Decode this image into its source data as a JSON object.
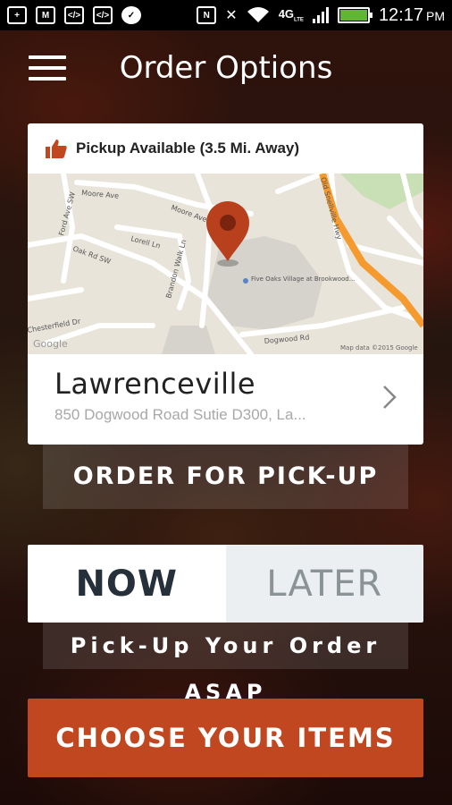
{
  "status_bar": {
    "time": "12:17",
    "ampm": "PM",
    "network": "4G",
    "network_sub": "LTE",
    "icons": [
      "plus-box-icon",
      "gmail-icon",
      "code-icon",
      "code-icon",
      "chat-icon",
      "nfc-icon",
      "mute-icon",
      "wifi-icon",
      "signal-icon",
      "battery-icon"
    ]
  },
  "header": {
    "title": "Order Options",
    "menu_icon": "hamburger-menu-icon"
  },
  "location_card": {
    "pickup_text": "Pickup Available (3.5 Mi. Away)",
    "pickup_icon": "thumbs-up-icon",
    "map": {
      "streets": [
        "Moore Ave",
        "Moore Ave",
        "Ford Ave SW",
        "Lorell Ln",
        "Brandon Walk Ln",
        "Oak Rd SW",
        "Chesterfield Dr",
        "Dogwood Rd",
        "Old Snellville Hwy"
      ],
      "poi": "Five Oaks Village at Brookwood...",
      "credit": "Map data ©2015 Google",
      "logo": "Google"
    },
    "name": "Lawrenceville",
    "address": "850 Dogwood Road Sutie D300, La...",
    "chevron_icon": "chevron-right-icon"
  },
  "order_pickup_label": "ORDER FOR PICK-UP",
  "timing": {
    "now_label": "NOW",
    "later_label": "LATER",
    "selected": "NOW"
  },
  "asap_label": "Pick-Up Your Order ASAP",
  "choose_items_label": "CHOOSE YOUR ITEMS",
  "colors": {
    "accent": "#c0471f",
    "pin": "#b8401c",
    "highway": "#f59a2f"
  }
}
